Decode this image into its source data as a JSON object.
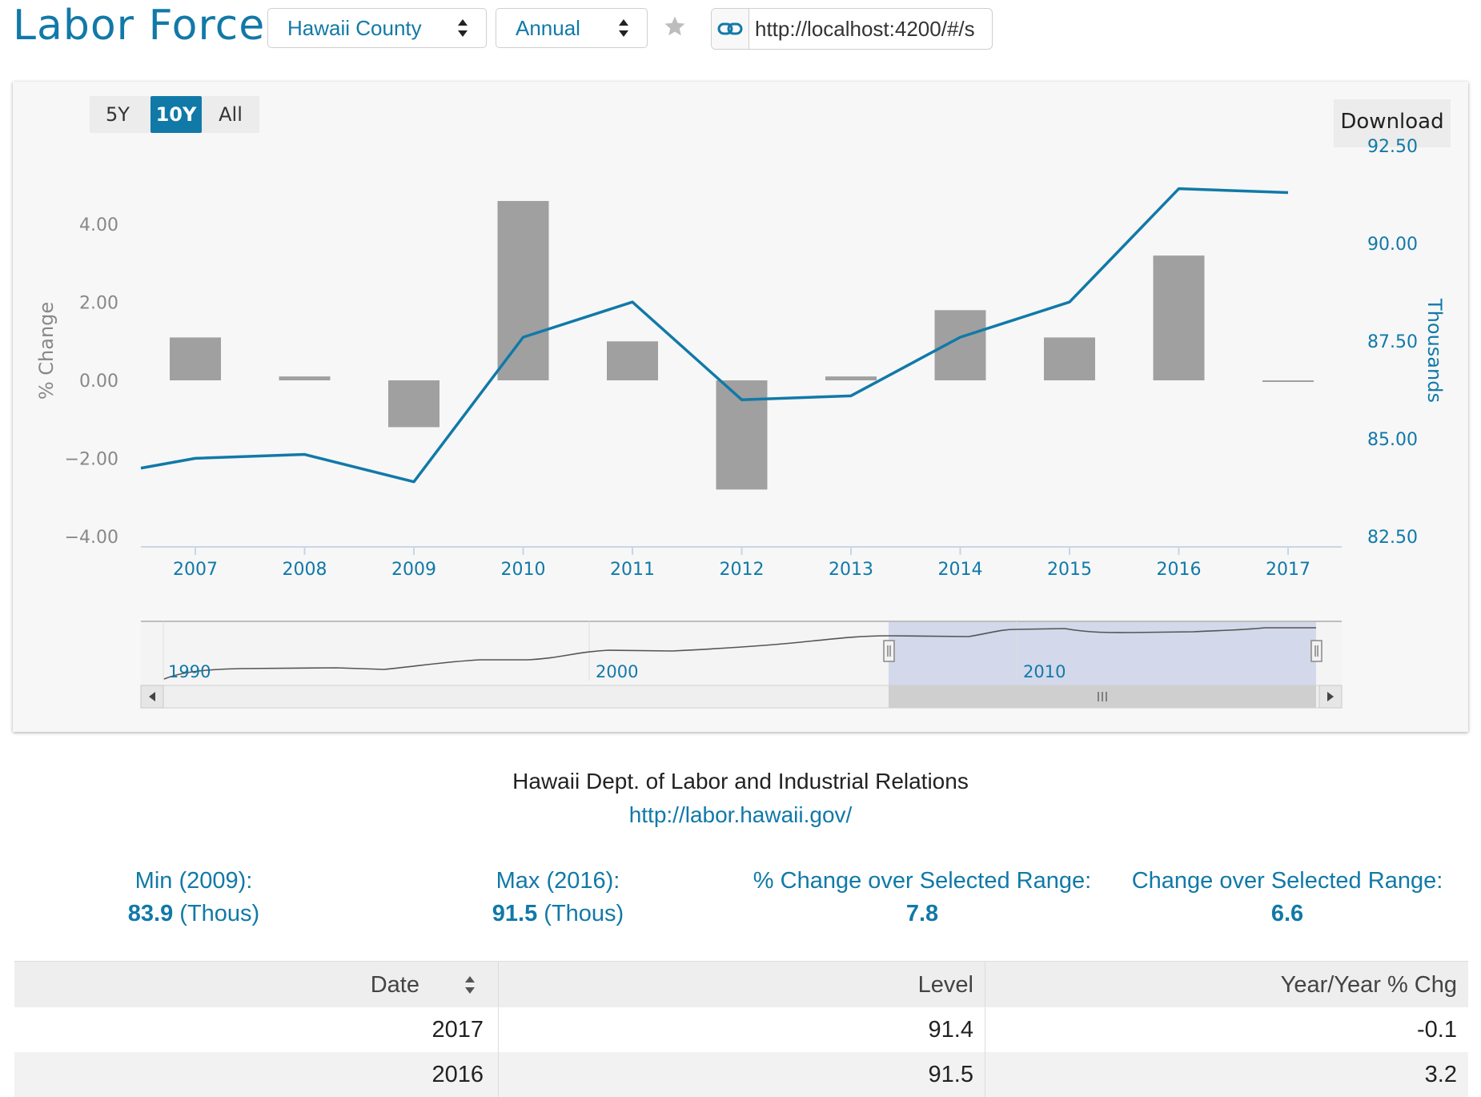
{
  "header": {
    "title": "Labor Force",
    "region_select": "Hawaii County",
    "frequency_select": "Annual",
    "share_url": "http://localhost:4200/#/s"
  },
  "chart_controls": {
    "range_buttons": [
      "5Y",
      "10Y",
      "All"
    ],
    "active_range": "10Y",
    "download_label": "Download"
  },
  "chart_data": {
    "type": "bar",
    "categories": [
      "2007",
      "2008",
      "2009",
      "2010",
      "2011",
      "2012",
      "2013",
      "2014",
      "2015",
      "2016",
      "2017"
    ],
    "series": [
      {
        "name": "% Change",
        "type": "bar",
        "axis": "left",
        "values": [
          1.1,
          0.1,
          -1.2,
          4.6,
          1.0,
          -2.8,
          0.1,
          1.8,
          1.1,
          3.2,
          0.0
        ]
      },
      {
        "name": "Thousands",
        "type": "line",
        "axis": "right",
        "values": [
          84.5,
          84.6,
          83.9,
          87.6,
          88.5,
          86.0,
          86.1,
          87.6,
          88.5,
          91.4,
          91.3
        ]
      }
    ],
    "y_left": {
      "label": "% Change",
      "ticks": [
        "4.00",
        "2.00",
        "0.00",
        "−2.00",
        "−4.00"
      ],
      "range": [
        -4,
        4
      ]
    },
    "y_right": {
      "label": "Thousands",
      "ticks": [
        "92.50",
        "90.00",
        "87.50",
        "85.00",
        "82.50"
      ],
      "range": [
        82.5,
        92.5
      ]
    },
    "colors": {
      "bar": "#a0a0a0",
      "line": "#1179a8",
      "axis_text_left": "#888888",
      "axis_text_right": "#1179a8"
    }
  },
  "navigator": {
    "labels": [
      "1990",
      "2000",
      "2010"
    ]
  },
  "source": {
    "name": "Hawaii Dept. of Labor and Industrial Relations",
    "link": "http://labor.hawaii.gov/"
  },
  "stats": [
    {
      "label": "Min (2009):",
      "value": "83.9",
      "unit": " (Thous)"
    },
    {
      "label": "Max (2016):",
      "value": "91.5",
      "unit": " (Thous)"
    },
    {
      "label": "% Change over Selected Range:",
      "value": "7.8",
      "unit": ""
    },
    {
      "label": "Change over Selected Range:",
      "value": "6.6",
      "unit": ""
    }
  ],
  "table": {
    "headers": [
      "Date",
      "Level",
      "Year/Year % Chg"
    ],
    "rows": [
      [
        "2017",
        "91.4",
        "-0.1"
      ],
      [
        "2016",
        "91.5",
        "3.2"
      ]
    ]
  }
}
